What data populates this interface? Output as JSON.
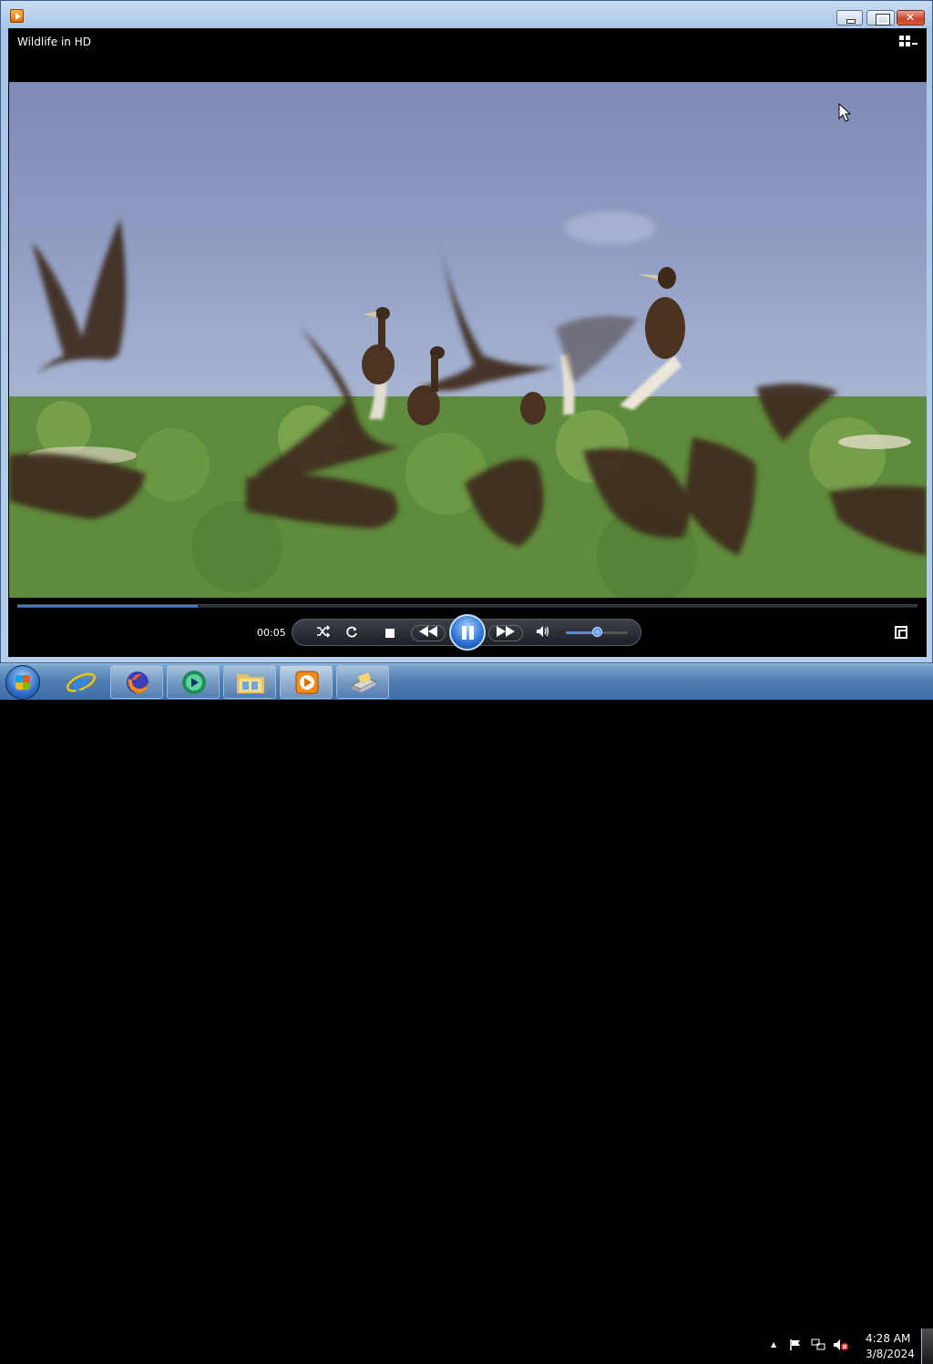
{
  "window": {
    "video_title": "Wildlife in HD",
    "icons": {
      "app": "media-player-icon",
      "minimize": "minimize-icon",
      "maximize": "maximize-icon",
      "close": "close-icon",
      "switch_library": "switch-to-library-icon"
    }
  },
  "player": {
    "elapsed_time": "00:05",
    "seek_progress": 0.2,
    "volume_level": 0.5,
    "state": "playing",
    "icons": [
      "shuffle-icon",
      "repeat-icon",
      "stop-icon",
      "previous-icon",
      "pause-icon",
      "next-icon",
      "volume-icon",
      "fullscreen-icon"
    ],
    "accent_color": "#2b6fd1"
  },
  "taskbar": {
    "pinned": [
      "start-icon",
      "internet-explorer-icon",
      "firefox-icon",
      "media-center-icon",
      "file-explorer-icon",
      "windows-media-player-icon",
      "unknown-app-icon"
    ],
    "tray_icons": [
      "show-hidden-icons-icon",
      "action-center-flag-icon",
      "network-icon",
      "volume-muted-icon"
    ],
    "clock": {
      "time": "4:28 AM",
      "date": "3/8/2024"
    }
  }
}
